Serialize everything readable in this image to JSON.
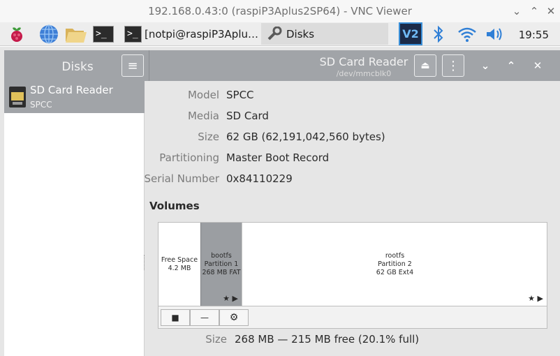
{
  "vnc": {
    "title": "192.168.0.43:0 (raspiP3Aplus2SP64) - VNC Viewer",
    "ctrl_min": "⌄",
    "ctrl_max": "⌃",
    "ctrl_close": "✕"
  },
  "taskbar": {
    "term_prompt": ">_",
    "tasks": [
      {
        "label": "[notpi@raspiP3Aplu…",
        "active": false
      },
      {
        "label": "Disks",
        "active": true
      }
    ],
    "clock": "19:55",
    "vnc_label": "V2"
  },
  "app": {
    "left_title": "Disks",
    "device_title": "SD Card Reader",
    "device_path": "/dev/mmcblk0",
    "menu_glyph": "≡",
    "eject_glyph": "⏏",
    "more_glyph": "⋮",
    "min_glyph": "⌄",
    "max_glyph": "⌃",
    "close_glyph": "✕"
  },
  "sidebar": {
    "items": [
      {
        "name": "SD Card Reader",
        "sub": "SPCC"
      }
    ]
  },
  "properties": [
    {
      "key": "Model",
      "value": "SPCC"
    },
    {
      "key": "Media",
      "value": "SD Card"
    },
    {
      "key": "Size",
      "value": "62 GB (62,191,042,560 bytes)"
    },
    {
      "key": "Partitioning",
      "value": "Master Boot Record"
    },
    {
      "key": "Serial Number",
      "value": "0x84110229"
    }
  ],
  "volumes": {
    "title": "Volumes",
    "segments": [
      {
        "line1": "Free Space",
        "line2": "4.2 MB",
        "line3": ""
      },
      {
        "line1": "bootfs",
        "line2": "Partition 1",
        "line3": "268 MB FAT",
        "marks": "★ ▶"
      },
      {
        "line1": "rootfs",
        "line2": "Partition 2",
        "line3": "62 GB Ext4",
        "marks": "★ ▶"
      }
    ],
    "toolbar": {
      "stop": "■",
      "remove": "—",
      "settings": "⚙"
    }
  },
  "selected": {
    "size_key": "Size",
    "size_value": "268 MB — 215 MB free (20.1% full)"
  }
}
